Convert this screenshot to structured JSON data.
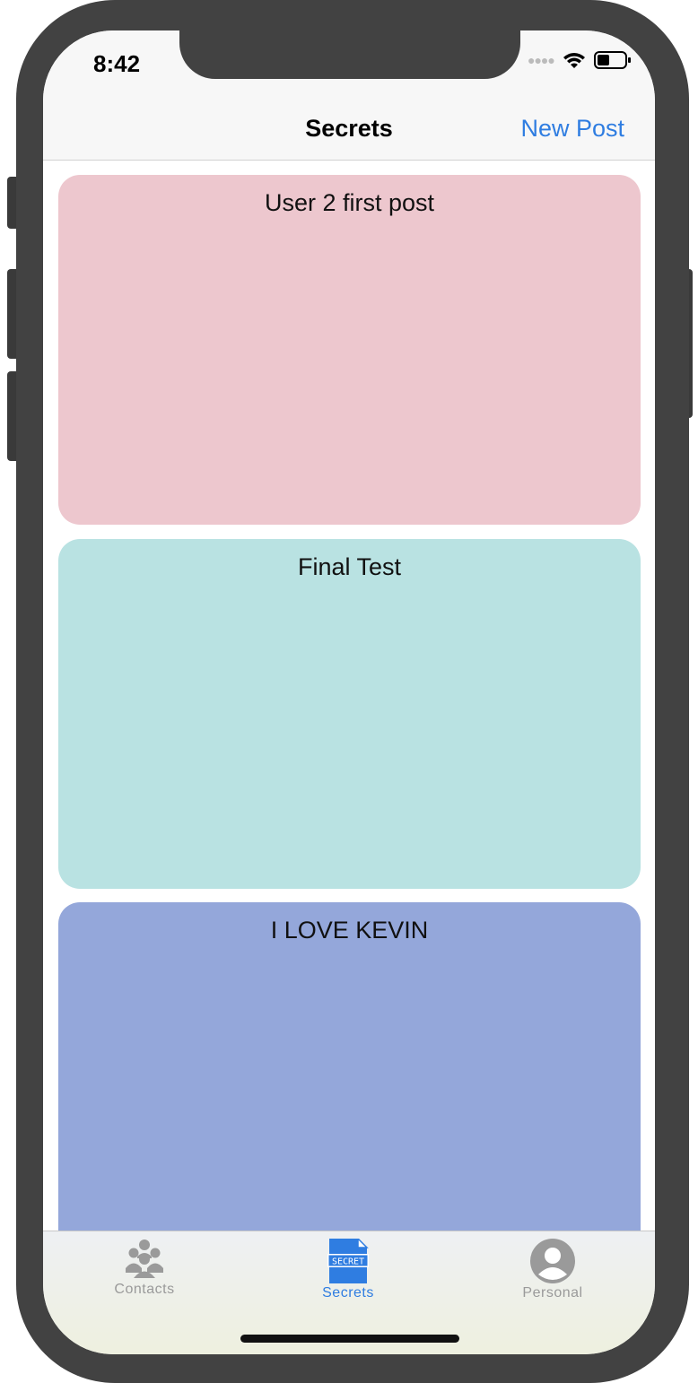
{
  "status_bar": {
    "time": "8:42"
  },
  "nav": {
    "title": "Secrets",
    "new_post_label": "New Post"
  },
  "posts": [
    {
      "text": "User 2 first post",
      "color": "#edc7ce"
    },
    {
      "text": "Final Test",
      "color": "#b9e2e2"
    },
    {
      "text": "I LOVE KEVIN",
      "color": "#94a7da"
    }
  ],
  "tabs": [
    {
      "label": "Contacts",
      "icon": "contacts-icon",
      "active": false,
      "color": "#9a9a9a"
    },
    {
      "label": "Secrets",
      "icon": "secret-file-icon",
      "active": true,
      "color": "#2f7de1",
      "icon_text": "SECRET"
    },
    {
      "label": "Personal",
      "icon": "person-circle-icon",
      "active": false,
      "color": "#9a9a9a"
    }
  ],
  "colors": {
    "accent": "#2f7de1",
    "inactive_tab": "#9a9a9a",
    "frame": "#424242"
  }
}
